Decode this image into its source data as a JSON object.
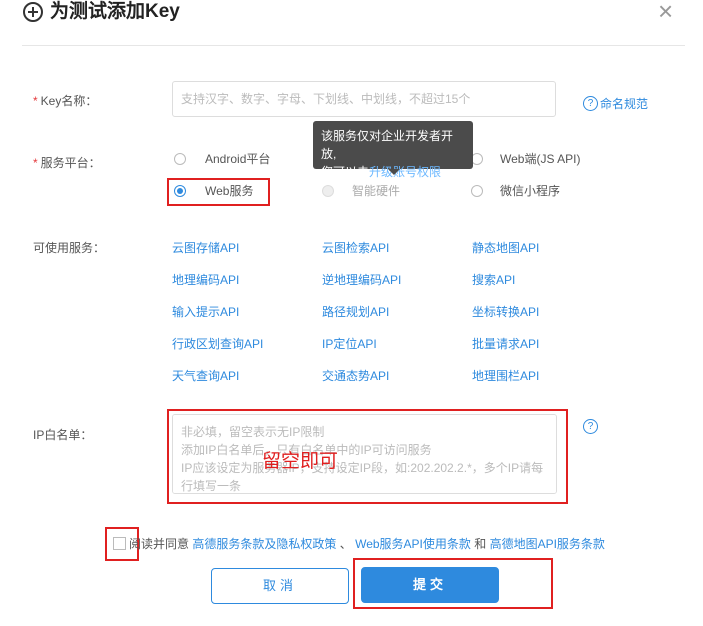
{
  "dialog": {
    "title": "为测试添加Key",
    "close": "×"
  },
  "key_name": {
    "star": "*",
    "label": "Key名称：",
    "placeholder": "支持汉字、数字、字母、下划线、中划线，不超过15个",
    "help_link": "命名规范",
    "help_icon": "?"
  },
  "platform": {
    "star": "*",
    "label": "服务平台：",
    "options": [
      {
        "label": "Android平台",
        "checked": false,
        "disabled": false
      },
      {
        "label": "Web端(JS API)",
        "checked": false,
        "disabled": false
      },
      {
        "label": "Web服务",
        "checked": true,
        "disabled": false
      },
      {
        "label": "智能硬件",
        "checked": false,
        "disabled": true
      },
      {
        "label": "微信小程序",
        "checked": false,
        "disabled": false
      }
    ],
    "tooltip_line1": "该服务仅对企业开发者开放,",
    "tooltip_line2_prefix": "您可以去",
    "tooltip_link": "升级账号权限"
  },
  "services": {
    "label": "可使用服务：",
    "items": [
      "云图存储API",
      "云图检索API",
      "静态地图API",
      "地理编码API",
      "逆地理编码API",
      "搜索API",
      "输入提示API",
      "路径规划API",
      "坐标转换API",
      "行政区划查询API",
      "IP定位API",
      "批量请求API",
      "天气查询API",
      "交通态势API",
      "地理围栏API"
    ]
  },
  "ip_whitelist": {
    "label": "IP白名单：",
    "placeholder": "非必填，留空表示无IP限制\n添加IP白名单后，只有白名单中的IP可访问服务\nIP应该设定为服务器IP，支持设定IP段，如:202.202.2.*，多个IP请每行填写一条",
    "help_icon": "?",
    "annotation": "留空即可"
  },
  "agreement": {
    "prefix": "阅读并同意",
    "link1": "高德服务条款及隐私权政策",
    "sep1": "、",
    "link2": "Web服务API使用条款",
    "sep2": "和",
    "link3": "高德地图API服务条款"
  },
  "buttons": {
    "cancel": "取消",
    "submit": "提交"
  },
  "colors": {
    "accent": "#2e8ade",
    "annotation_red": "#e02020",
    "required_star": "#e4393c"
  }
}
